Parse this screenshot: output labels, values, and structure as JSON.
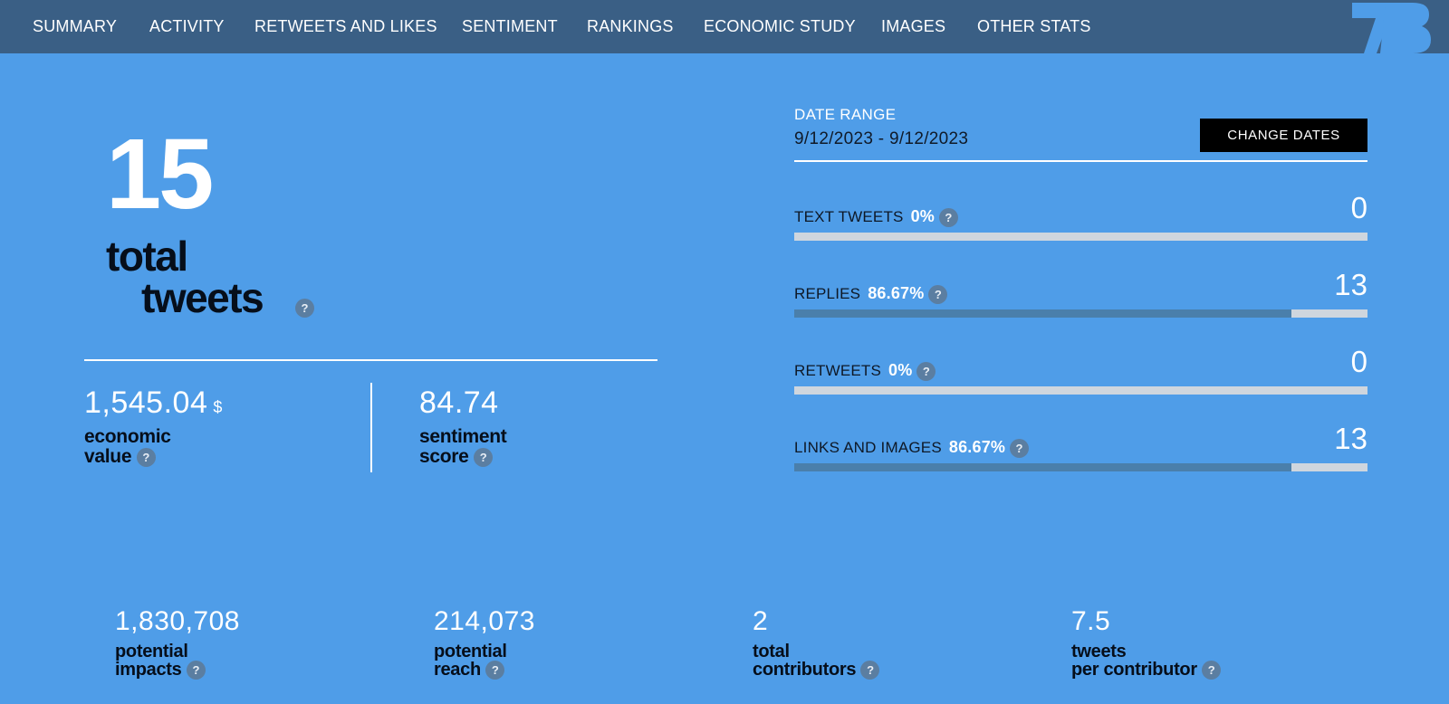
{
  "nav": {
    "items": [
      "SUMMARY",
      "ACTIVITY",
      "RETWEETS AND LIKES",
      "SENTIMENT",
      "RANKINGS",
      "ECONOMIC STUDY",
      "IMAGES",
      "OTHER STATS"
    ]
  },
  "summary": {
    "total_tweets": "15",
    "total_label_line1": "total",
    "total_label_line2": "tweets",
    "economic_value": "1,545.04",
    "economic_currency": "$",
    "economic_label_line1": "economic",
    "economic_label_line2": "value",
    "sentiment_score": "84.74",
    "sentiment_label_line1": "sentiment",
    "sentiment_label_line2": "score"
  },
  "date_range": {
    "title": "DATE RANGE",
    "value": "9/12/2023 - 9/12/2023",
    "change_button": "CHANGE DATES"
  },
  "stats": [
    {
      "label": "TEXT TWEETS",
      "percent": "0%",
      "count": "0",
      "fill_fraction": 0
    },
    {
      "label": "REPLIES",
      "percent": "86.67%",
      "count": "13",
      "fill_fraction": 0.8667
    },
    {
      "label": "RETWEETS",
      "percent": "0%",
      "count": "0",
      "fill_fraction": 0
    },
    {
      "label": "LINKS AND IMAGES",
      "percent": "86.67%",
      "count": "13",
      "fill_fraction": 0.8667
    }
  ],
  "bottom_stats": [
    {
      "value": "1,830,708",
      "line1": "potential",
      "line2": "impacts"
    },
    {
      "value": "214,073",
      "line1": "potential",
      "line2": "reach"
    },
    {
      "value": "2",
      "line1": "total",
      "line2": "contributors"
    },
    {
      "value": "7.5",
      "line1": "tweets",
      "line2": "per contributor"
    }
  ],
  "help_glyph": "?",
  "colors": {
    "background": "#4f9de8",
    "nav_background": "#3a5f85",
    "bar_fill": "#4a7fab",
    "bar_track": "#cfd6de",
    "dark_text": "#060e1a"
  }
}
